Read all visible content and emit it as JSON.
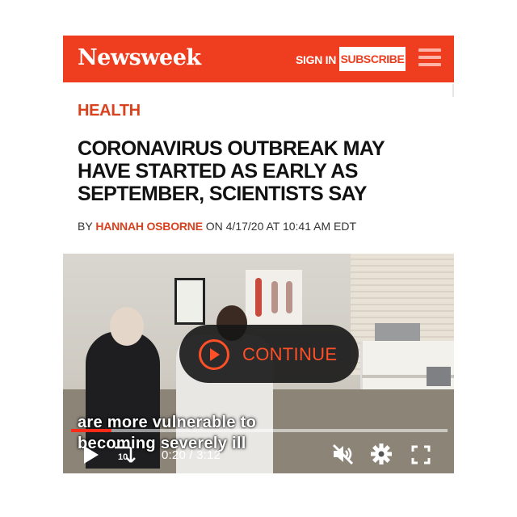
{
  "header": {
    "logo": "Newsweek",
    "sign_in_label": "SIGN IN",
    "subscribe_label": "SUBSCRIBE",
    "brand_color": "#ee3d1f",
    "menu_icon": "hamburger-menu-icon"
  },
  "article": {
    "section": "HEALTH",
    "headline": "CORONAVIRUS OUTBREAK MAY HAVE STARTED AS EARLY AS SEPTEMBER, SCIENTISTS SAY",
    "byline_prefix": "BY ",
    "author": "HANNAH OSBORNE",
    "byline_date": " ON 4/17/20 AT 10:41 AM EDT",
    "accent_color": "#d9421f"
  },
  "video": {
    "continue_label": "CONTINUE",
    "caption_line1": "are more vulnerable to",
    "caption_line2": "becoming severely ill",
    "progress_fraction": 0.107,
    "rewind_label": "10",
    "time_display": "0:20 / 3:12",
    "controls": {
      "play_icon": "play-icon",
      "rewind_icon": "rewind-10-icon",
      "mute_icon": "muted-speaker-icon",
      "settings_icon": "gear-icon",
      "fullscreen_icon": "fullscreen-icon"
    },
    "progress_color": "#ff2a17"
  }
}
